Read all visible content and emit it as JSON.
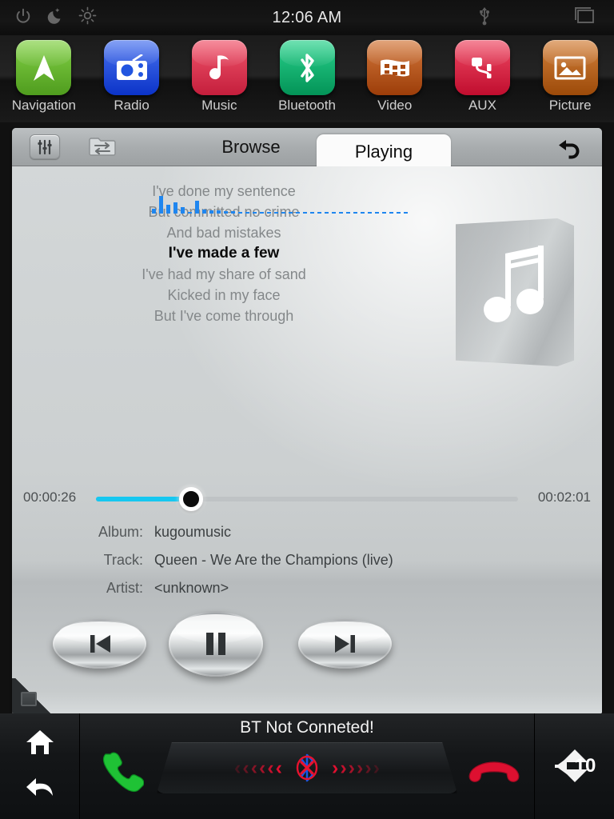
{
  "status_bar": {
    "clock": "12:06 AM",
    "left_icons": [
      {
        "name": "power-icon"
      },
      {
        "name": "night-mode-icon"
      },
      {
        "name": "brightness-icon"
      }
    ],
    "right_icons": [
      {
        "name": "usb-icon"
      },
      {
        "name": "multitask-windows-icon"
      }
    ]
  },
  "app_dock": {
    "items": [
      {
        "label": "Navigation",
        "icon": "navigation-arrow-icon",
        "color": "#64bb2b"
      },
      {
        "label": "Radio",
        "icon": "radio-icon",
        "color": "#1b4fe0"
      },
      {
        "label": "Music",
        "icon": "music-note-icon",
        "color": "#e0334d"
      },
      {
        "label": "Bluetooth",
        "icon": "bluetooth-icon",
        "color": "#12b06a"
      },
      {
        "label": "Video",
        "icon": "film-strip-icon",
        "color": "#c4561a"
      },
      {
        "label": "AUX",
        "icon": "aux-cable-icon",
        "color": "#e01b3e"
      },
      {
        "label": "Picture",
        "icon": "picture-icon",
        "color": "#c4621a"
      }
    ]
  },
  "player": {
    "toolbar": {
      "equalizer_icon": "equalizer-icon",
      "folder_swap_icon": "folder-swap-icon",
      "return_icon": "return-arrow-icon"
    },
    "tabs": [
      {
        "label": "Browse",
        "active": false
      },
      {
        "label": "Playing",
        "active": true
      }
    ],
    "lyrics": [
      {
        "text": "I've done my sentence",
        "current": false
      },
      {
        "text": "But committed no crime",
        "current": false
      },
      {
        "text": "And bad mistakes",
        "current": false
      },
      {
        "text": "I've made a few",
        "current": true
      },
      {
        "text": "I've had my share of sand",
        "current": false
      },
      {
        "text": "Kicked in my face",
        "current": false
      },
      {
        "text": "But I've come through",
        "current": false
      }
    ],
    "album_art_icon": "music-note-album-art-icon",
    "progress": {
      "current_time": "00:00:26",
      "total_time": "00:02:01",
      "percent": 22.5,
      "fill_color": "#16c7f0"
    },
    "spectrum": {
      "color": "#1f86ef",
      "values": [
        6,
        22,
        11,
        14,
        8,
        2,
        16,
        5,
        4,
        4,
        3,
        3,
        2,
        2,
        2,
        2,
        2,
        2,
        2,
        2,
        2,
        2,
        2,
        2,
        2,
        2,
        2,
        2,
        2,
        2,
        2,
        2,
        2,
        2,
        2,
        2
      ]
    },
    "metadata": [
      {
        "key": "Album:",
        "value": "kugoumusic"
      },
      {
        "key": "Track:",
        "value": "Queen - We Are the Champions (live)"
      },
      {
        "key": "Artist:",
        "value": "<unknown>"
      }
    ],
    "transport": [
      {
        "name": "previous-track-button",
        "icon": "previous-icon"
      },
      {
        "name": "play-pause-button",
        "icon": "pause-icon"
      },
      {
        "name": "next-track-button",
        "icon": "next-icon"
      }
    ],
    "corner_button_icon": "resize-corner-icon"
  },
  "bottom_bar": {
    "home_icon": "home-icon",
    "back_icon": "back-arrow-icon",
    "answer_call_icon": "phone-answer-icon",
    "hangup_call_icon": "phone-hangup-icon",
    "bt_status": "BT Not Conneted!",
    "bt_disconnected_icon": "bluetooth-disconnected-icon",
    "chevron_left_count": 6,
    "chevron_right_count": 6,
    "volume": {
      "value": "10",
      "up_icon": "volume-up-icon",
      "down_icon": "volume-down-icon",
      "speaker_icon": "speaker-icon"
    }
  }
}
